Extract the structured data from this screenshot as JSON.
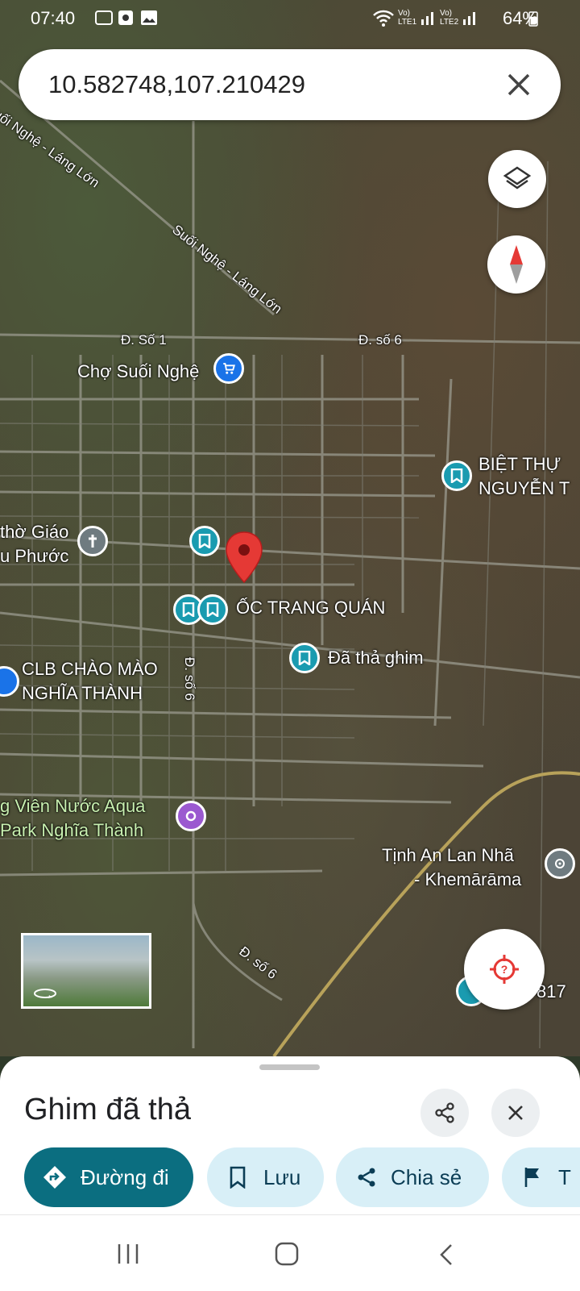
{
  "status_bar": {
    "time": "07:40",
    "battery": "64%",
    "sim1": "Vo) LTE1",
    "sim2": "Vo) LTE2"
  },
  "search": {
    "query": "10.582748,107.210429"
  },
  "map": {
    "roads": {
      "r1": "Suối Nghệ - Láng Lớn",
      "r2": "Suối Nghệ - Láng Lớn",
      "r3": "Đ. Số 1",
      "r4": "Đ. số 6",
      "r5": "Đ. số 6",
      "r6": "Đ. số 6"
    },
    "labels": {
      "cho": "Chợ Suối Nghệ",
      "biet_thu_1": "BIỆT THỰ",
      "biet_thu_2": "NGUYỄN T",
      "nha_tho_1": "thờ Giáo",
      "nha_tho_2": "u Phước",
      "oc_trang": "ỐC TRANG QUÁN",
      "da_tha": "Đã thả ghim",
      "clb_1": "CLB CHÀO MÀO",
      "clb_2": "NGHĨA THÀNH",
      "aqua_1": "g Viên Nước Aqua",
      "aqua_2": "Park Nghĩa Thành",
      "tinh_1": "Tịnh An Lan Nhã",
      "tinh_2": "- Khemārāma",
      "num": "817"
    }
  },
  "bottom_sheet": {
    "title": "Ghim đã thả",
    "actions": {
      "directions": "Đường đi",
      "save": "Lưu",
      "share": "Chia sẻ",
      "more": "T"
    }
  },
  "colors": {
    "primary": "#0b6e80",
    "chip": "#d8eff7",
    "pin": "#e53935",
    "poi_teal": "#1a9bb0"
  }
}
